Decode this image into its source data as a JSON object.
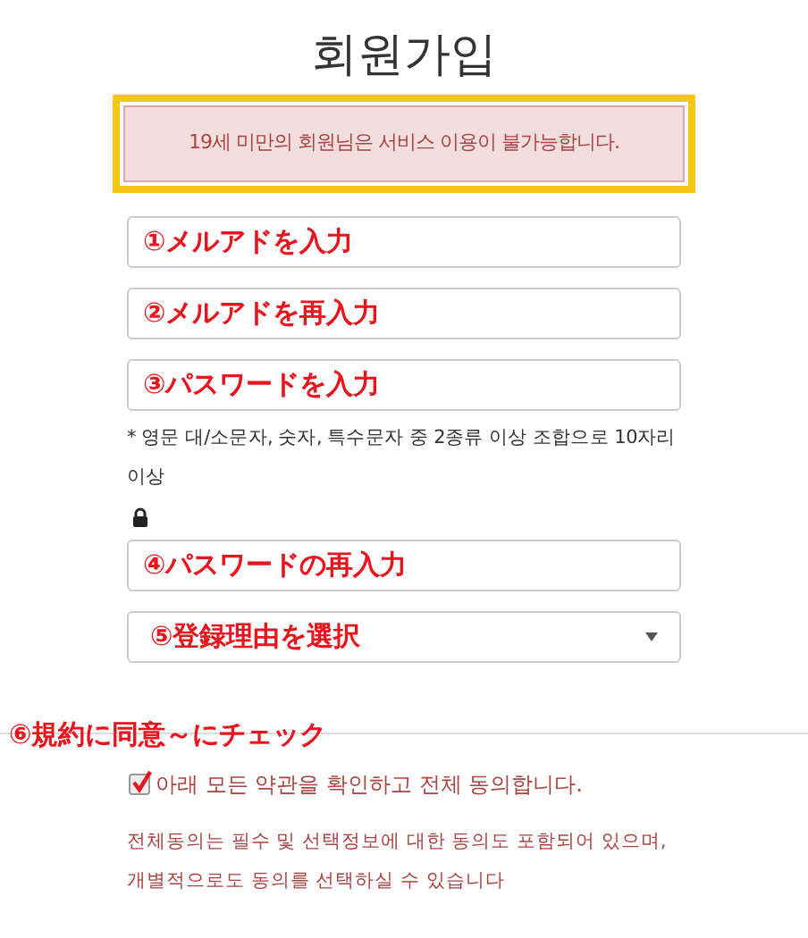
{
  "title": "회원가입",
  "alert": {
    "text": "19세 미만의 회원님은 서비스 이용이 불가능합니다."
  },
  "fields": [
    {
      "kind": "input",
      "annotation": "①メルアドを入力"
    },
    {
      "kind": "input",
      "annotation": "②メルアドを再入力"
    },
    {
      "kind": "input",
      "annotation": "③パスワードを入力",
      "help": "* 영문 대/소문자, 숫자, 특수문자 중 2종류 이상 조합으로 10자리 이상"
    },
    {
      "kind": "input",
      "annotation": "④パスワードの再入力"
    },
    {
      "kind": "select",
      "annotation": "⑤登録理由を選択"
    }
  ],
  "agree_annotation": "⑥規約に同意～にチェック",
  "agree": {
    "label": "아래 모든 약관을 확인하고 전체 동의합니다.",
    "checked": true
  },
  "note": [
    "전체동의는 필수 및 선택정보에 대한 동의도 포함되어 있으며,",
    "개별적으로도 동의를 선택하실 수 있습니다"
  ]
}
